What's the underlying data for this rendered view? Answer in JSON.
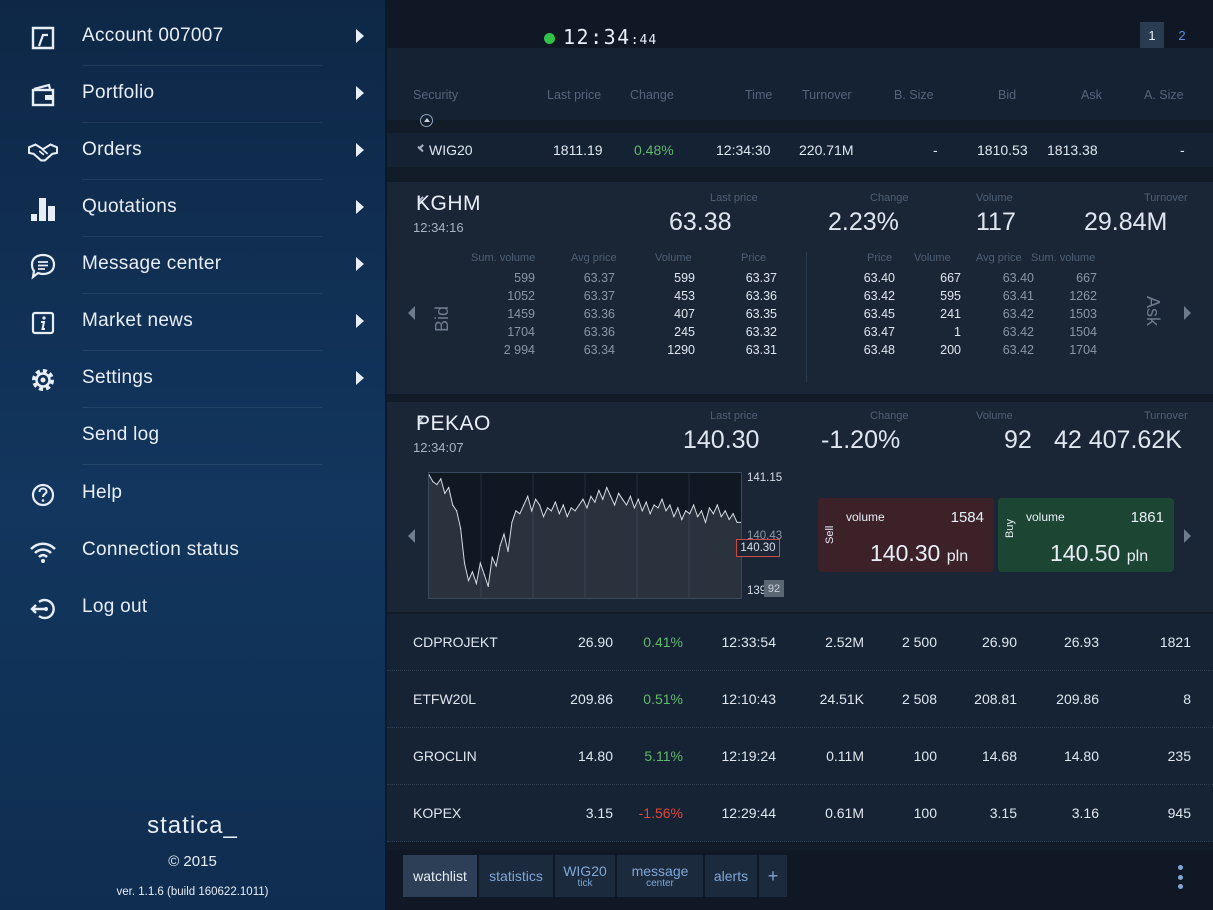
{
  "sidebar": {
    "items": [
      {
        "label": "Account 007007",
        "icon": "account-icon",
        "arrow": true
      },
      {
        "label": "Portfolio",
        "icon": "wallet-icon",
        "arrow": true
      },
      {
        "label": "Orders",
        "icon": "handshake-icon",
        "arrow": true
      },
      {
        "label": "Quotations",
        "icon": "bar-chart-icon",
        "arrow": true
      },
      {
        "label": "Message center",
        "icon": "chat-icon",
        "arrow": true
      },
      {
        "label": "Market news",
        "icon": "info-icon",
        "arrow": true
      },
      {
        "label": "Settings",
        "icon": "gear-icon",
        "arrow": true
      },
      {
        "label": "Send log",
        "icon": "",
        "arrow": false
      },
      {
        "label": "Help",
        "icon": "help-icon",
        "arrow": false
      },
      {
        "label": "Connection status",
        "icon": "wifi-icon",
        "arrow": false
      },
      {
        "label": "Log out",
        "icon": "logout-icon",
        "arrow": false
      }
    ],
    "brand": "statica_",
    "copyright": "2015",
    "version": "ver. 1.1.6 (build 160622.1011)"
  },
  "topbar": {
    "time_main": "12:34",
    "time_sec": ":44",
    "status_color": "#31c048",
    "pages": [
      "1",
      "2"
    ]
  },
  "watchlist": {
    "headers": {
      "security": "Security",
      "last_price": "Last price",
      "change": "Change",
      "time": "Time",
      "turnover": "Turnover",
      "b_size": "B. Size",
      "bid": "Bid",
      "ask": "Ask",
      "a_size": "A. Size"
    },
    "wig20": {
      "name": "WIG20",
      "last_price": "1811.19",
      "change": "0.48%",
      "time": "12:34:30",
      "turnover": "220.71M",
      "b_size": "-",
      "bid": "1810.53",
      "ask": "1813.38",
      "a_size": "-"
    },
    "rows": [
      {
        "name": "CDPROJEKT",
        "last_price": "26.90",
        "change": "0.41%",
        "dir": "up",
        "time": "12:33:54",
        "turnover": "2.52M",
        "b_size": "2 500",
        "bid": "26.90",
        "ask": "26.93",
        "a_size": "1821"
      },
      {
        "name": "ETFW20L",
        "last_price": "209.86",
        "change": "0.51%",
        "dir": "up",
        "time": "12:10:43",
        "turnover": "24.51K",
        "b_size": "2 508",
        "bid": "208.81",
        "ask": "209.86",
        "a_size": "8"
      },
      {
        "name": "GROCLIN",
        "last_price": "14.80",
        "change": "5.11%",
        "dir": "up",
        "time": "12:19:24",
        "turnover": "0.11M",
        "b_size": "100",
        "bid": "14.68",
        "ask": "14.80",
        "a_size": "235"
      },
      {
        "name": "KOPEX",
        "last_price": "3.15",
        "change": "-1.56%",
        "dir": "down",
        "time": "12:29:44",
        "turnover": "0.61M",
        "b_size": "100",
        "bid": "3.15",
        "ask": "3.16",
        "a_size": "945"
      }
    ]
  },
  "kghm": {
    "name": "KGHM",
    "time": "12:34:16",
    "labels": {
      "last_price": "Last price",
      "change": "Change",
      "volume": "Volume",
      "turnover": "Turnover"
    },
    "last_price": "63.38",
    "change": "2.23%",
    "volume": "117",
    "turnover": "29.84M",
    "book_headers": {
      "sum_volume": "Sum. volume",
      "avg_price": "Avg price",
      "volume": "Volume",
      "price": "Price"
    },
    "bid_label": "Bid",
    "ask_label": "Ask",
    "bids": [
      {
        "sum_volume": "599",
        "avg_price": "63.37",
        "volume": "599",
        "price": "63.37"
      },
      {
        "sum_volume": "1052",
        "avg_price": "63.37",
        "volume": "453",
        "price": "63.36"
      },
      {
        "sum_volume": "1459",
        "avg_price": "63.36",
        "volume": "407",
        "price": "63.35"
      },
      {
        "sum_volume": "1704",
        "avg_price": "63.36",
        "volume": "245",
        "price": "63.32"
      },
      {
        "sum_volume": "2 994",
        "avg_price": "63.34",
        "volume": "1290",
        "price": "63.31"
      }
    ],
    "asks": [
      {
        "price": "63.40",
        "volume": "667",
        "avg_price": "63.40",
        "sum_volume": "667"
      },
      {
        "price": "63.42",
        "volume": "595",
        "avg_price": "63.41",
        "sum_volume": "1262"
      },
      {
        "price": "63.45",
        "volume": "241",
        "avg_price": "63.42",
        "sum_volume": "1503"
      },
      {
        "price": "63.47",
        "volume": "1",
        "avg_price": "63.42",
        "sum_volume": "1504"
      },
      {
        "price": "63.48",
        "volume": "200",
        "avg_price": "63.42",
        "sum_volume": "1704"
      }
    ]
  },
  "pekao": {
    "name": "PEKAO",
    "time": "12:34:07",
    "labels": {
      "last_price": "Last price",
      "change": "Change",
      "volume": "Volume",
      "turnover": "Turnover"
    },
    "last_price": "140.30",
    "change": "-1.20%",
    "volume": "92",
    "turnover": "42 407.62K",
    "chart": {
      "high_label": "141.15",
      "mid_label": "140.43",
      "low_label": "139",
      "price_tag": "140.30",
      "volume_tag": "92"
    },
    "sell": {
      "side": "Sell",
      "volume_label": "volume",
      "volume": "1584",
      "price": "140.30",
      "currency": "pln"
    },
    "buy": {
      "side": "Buy",
      "volume_label": "volume",
      "volume": "1861",
      "price": "140.50",
      "currency": "pln"
    }
  },
  "chart_data": {
    "type": "line",
    "x": [
      0,
      1,
      2,
      3,
      4,
      5,
      6,
      7,
      8,
      9,
      10,
      11,
      12,
      13,
      14,
      15,
      16,
      17,
      18,
      19,
      20,
      21,
      22,
      23,
      24,
      25,
      26,
      27,
      28,
      29,
      30,
      31,
      32,
      33,
      34,
      35,
      36,
      37,
      38,
      39,
      40,
      41,
      42,
      43,
      44,
      45,
      46,
      47,
      48,
      49,
      50,
      51,
      52,
      53,
      54,
      55,
      56,
      57,
      58,
      59,
      60,
      61,
      62,
      63,
      64,
      65,
      66,
      67,
      68,
      69,
      70,
      71,
      72,
      73,
      74,
      75,
      76,
      77,
      78,
      79
    ],
    "values": [
      141.12,
      141.0,
      140.95,
      141.05,
      140.8,
      140.9,
      140.6,
      140.5,
      140.2,
      139.6,
      139.3,
      139.45,
      139.25,
      139.6,
      139.4,
      139.2,
      139.7,
      139.55,
      139.9,
      140.1,
      139.8,
      140.3,
      140.5,
      140.45,
      140.6,
      140.75,
      140.5,
      140.7,
      140.6,
      140.4,
      140.55,
      140.5,
      140.65,
      140.45,
      140.6,
      140.4,
      140.55,
      140.5,
      140.6,
      140.7,
      140.55,
      140.75,
      140.65,
      140.85,
      140.7,
      140.9,
      140.75,
      140.6,
      140.8,
      140.7,
      140.6,
      140.75,
      140.55,
      140.7,
      140.5,
      140.65,
      140.45,
      140.6,
      140.55,
      140.7,
      140.5,
      140.6,
      140.4,
      140.55,
      140.35,
      140.5,
      140.45,
      140.6,
      140.4,
      140.5,
      140.3,
      140.55,
      140.45,
      140.6,
      140.4,
      140.5,
      140.35,
      140.45,
      140.3,
      140.3
    ],
    "ylim": [
      139,
      141.15
    ],
    "grid": true
  }
}
